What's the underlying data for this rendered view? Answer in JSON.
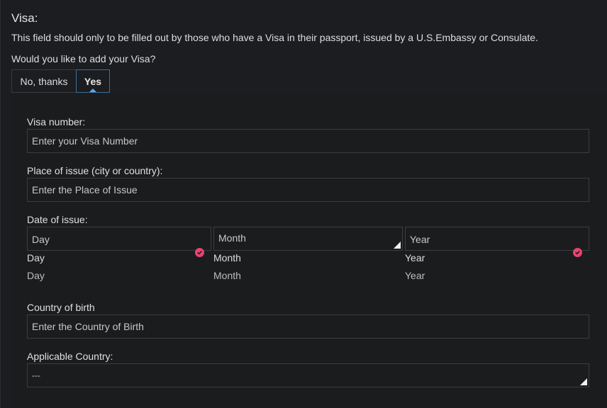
{
  "section": {
    "title": "Visa:",
    "description": "This field should only to be filled out by those who have a Visa in their passport, issued by a U.S.Embassy or Consulate.",
    "question": "Would you like to add your Visa?",
    "toggle": {
      "no_label": "No, thanks",
      "yes_label": "Yes",
      "selected": "Yes"
    }
  },
  "fields": {
    "visa_number": {
      "label": "Visa number:",
      "placeholder": "Enter your Visa Number"
    },
    "place_of_issue": {
      "label": "Place of issue (city or country):",
      "placeholder": "Enter the Place of Issue"
    },
    "date_of_issue": {
      "label": "Date of issue:",
      "day": {
        "value": "Day",
        "options": [
          "Day",
          "Day"
        ]
      },
      "month": {
        "value": "Month",
        "options": [
          "Month",
          "Month"
        ]
      },
      "year": {
        "value": "Year",
        "options": [
          "Year",
          "Year"
        ]
      }
    },
    "country_of_birth": {
      "label": "Country of birth",
      "placeholder": "Enter the Country of Birth"
    },
    "applicable_country": {
      "label": "Applicable Country:",
      "value": "---"
    }
  },
  "icons": {
    "valid": "check-circle-icon",
    "resize": "resize-handle-icon"
  },
  "colors": {
    "accent": "#3d6d9a",
    "valid": "#e8436f"
  }
}
